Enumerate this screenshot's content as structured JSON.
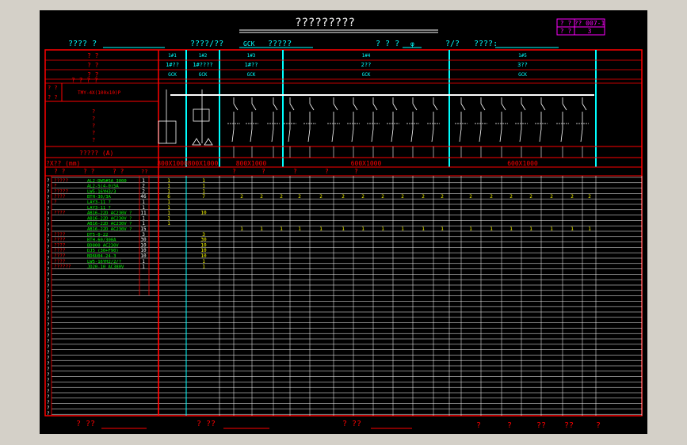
{
  "title": "?????????",
  "corner_box": {
    "r1c1": "? ?",
    "r1c2": "?? 007-1",
    "r2c1": "? ?",
    "r2c2": "3"
  },
  "header": {
    "f1": "???? ?",
    "f2": "????/??",
    "f3": "GCK",
    "f4": "?????",
    "f5": "? ? ?",
    "f6": "φ",
    "f7": "?/?",
    "f8": "????:"
  },
  "panels": [
    {
      "id": "1#1",
      "name": "1#??",
      "type": "GCK"
    },
    {
      "id": "1#2",
      "name": "1#????",
      "type": "GCK"
    },
    {
      "id": "1#3",
      "name": "1#??",
      "type": "GCK"
    },
    {
      "id": "1#4",
      "name": "2??",
      "type": "GCK"
    },
    {
      "id": "1#5",
      "name": "3??",
      "type": "GCK"
    }
  ],
  "left_labels": {
    "r1": "? ?",
    "r2": "? ?",
    "r3": "? ?",
    "r4": "? ? ? ?",
    "busbar_a": "? ?",
    "busbar_b": "? ?",
    "busbar_code": "TMY-4X(100x10)P",
    "diagram": [
      "?",
      "?",
      "?",
      "?",
      "?"
    ],
    "rated_current": "????? (A)",
    "size": "?X?? (mm)"
  },
  "sizes": [
    "800X1000",
    "800X1000",
    "800X1000",
    "600X1000",
    "600X1000"
  ],
  "col_header": {
    "a": "? ?",
    "b": "? ?",
    "c": "? ?",
    "d": "??"
  },
  "col_header_right": [
    "?",
    "?",
    "?",
    "?",
    "?"
  ],
  "left_vertical": [
    "?",
    "?",
    "?",
    "?",
    "?",
    "?",
    "?",
    "?",
    "?",
    "?",
    "?",
    "?",
    "?",
    "?",
    "?",
    "?",
    "?",
    "?",
    "?",
    "?",
    "?",
    "?",
    "?",
    "?",
    "?",
    "?",
    "?",
    "?",
    "?",
    "?",
    "?",
    "?",
    "?",
    "?",
    "?",
    "?",
    "?",
    "?",
    "?",
    "?",
    "?",
    "?",
    "?"
  ],
  "equip_rows": [
    {
      "name": "?????",
      "model": "AL2-DW5#5A 3000",
      "qty": "1",
      "p1": "1",
      "p2": "1",
      "rest": ""
    },
    {
      "name": "?",
      "model": "AL2-S(4-0)5A",
      "qty": "2",
      "p1": "1",
      "p2": "1",
      "rest": ""
    },
    {
      "name": "?????",
      "model": "LW5-16YH3/3",
      "qty": "2",
      "p1": "1",
      "p2": "1",
      "rest": ""
    },
    {
      "name": "????",
      "model": "BTH-30/3A",
      "qty": "46",
      "p1": "6",
      "p2": "7",
      "rest": "2"
    },
    {
      "name": "?",
      "model": "LAY3-11 ?",
      "qty": "1",
      "p1": "1",
      "p2": "",
      "rest": ""
    },
    {
      "name": "",
      "model": "LAY3-11 ?",
      "qty": "1",
      "p1": "1",
      "p2": "",
      "rest": ""
    },
    {
      "name": "????",
      "model": "AB16-22D AC230V ?",
      "qty": "11",
      "p1": "1",
      "p2": "10",
      "rest": ""
    },
    {
      "name": "",
      "model": "AB16-22D AC230V ?",
      "qty": "1",
      "p1": "1",
      "p2": "",
      "rest": ""
    },
    {
      "name": "",
      "model": "AB16-22D AC230V ?",
      "qty": "1",
      "p1": "1",
      "p2": "",
      "rest": ""
    },
    {
      "name": "",
      "model": "AB16-22D AC230V ?",
      "qty": "15",
      "p1": "",
      "p2": "",
      "rest": "1"
    },
    {
      "name": "????",
      "model": "DT5-0-22",
      "qty": "3",
      "p1": "",
      "p2": "3",
      "rest": ""
    },
    {
      "name": "????",
      "model": "BTH-60/300A",
      "qty": "30",
      "p1": "",
      "p2": "30",
      "rest": ""
    },
    {
      "name": "????",
      "model": "BD800 AC230V",
      "qty": "10",
      "p1": "",
      "p2": "10",
      "rest": ""
    },
    {
      "name": "????",
      "model": "DJ5 (30+F90)",
      "qty": "10",
      "p1": "",
      "p2": "10",
      "rest": ""
    },
    {
      "name": "????",
      "model": "BD6U04-24-3",
      "qty": "10",
      "p1": "",
      "p2": "10",
      "rest": ""
    },
    {
      "name": "????",
      "model": "LW5-16YH2/2/?",
      "qty": "1",
      "p1": "",
      "p2": "1",
      "rest": ""
    },
    {
      "name": "??????",
      "model": "JD20-10 AC380V",
      "qty": "1",
      "p1": "",
      "p2": "1",
      "rest": ""
    }
  ],
  "footer": {
    "f1": "? ??",
    "f2": "? ??",
    "f3": "? ??",
    "f4": "?",
    "f5": "?",
    "f6": "??",
    "f7": "??",
    "f8": "?"
  }
}
